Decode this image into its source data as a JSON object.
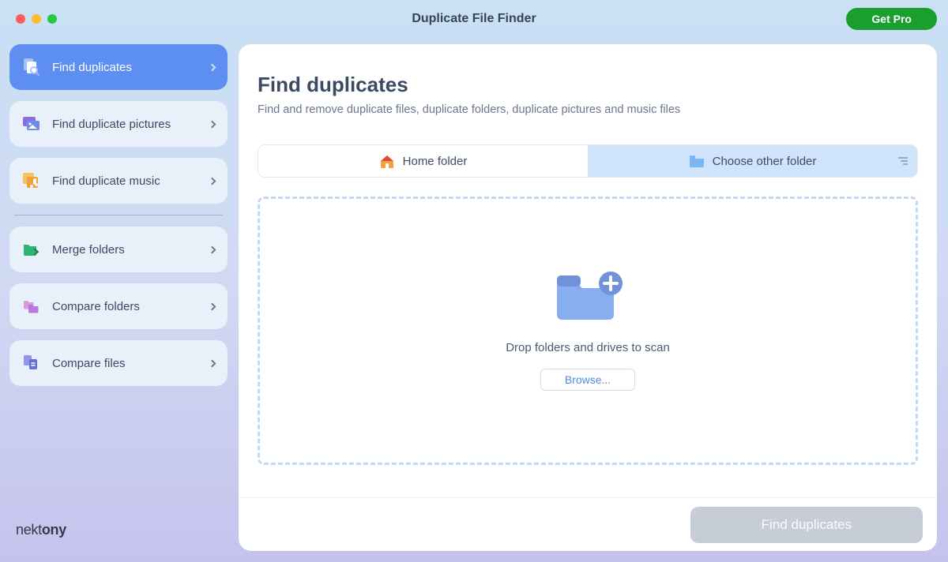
{
  "app": {
    "title": "Duplicate File Finder",
    "get_pro": "Get Pro",
    "brand_thin": "nekt",
    "brand_bold": "ony"
  },
  "sidebar": {
    "items": [
      {
        "label": "Find duplicates",
        "active": true
      },
      {
        "label": "Find duplicate pictures",
        "active": false
      },
      {
        "label": "Find duplicate music",
        "active": false
      },
      {
        "label": "Merge folders",
        "active": false
      },
      {
        "label": "Compare folders",
        "active": false
      },
      {
        "label": "Compare files",
        "active": false
      }
    ]
  },
  "main": {
    "title": "Find duplicates",
    "subtitle": "Find and remove duplicate files, duplicate folders, duplicate pictures and music files",
    "segments": {
      "home": "Home folder",
      "other": "Choose other folder",
      "selected": "other"
    },
    "dropzone": {
      "label": "Drop folders and drives to scan",
      "browse": "Browse..."
    },
    "primary_action": "Find duplicates"
  }
}
